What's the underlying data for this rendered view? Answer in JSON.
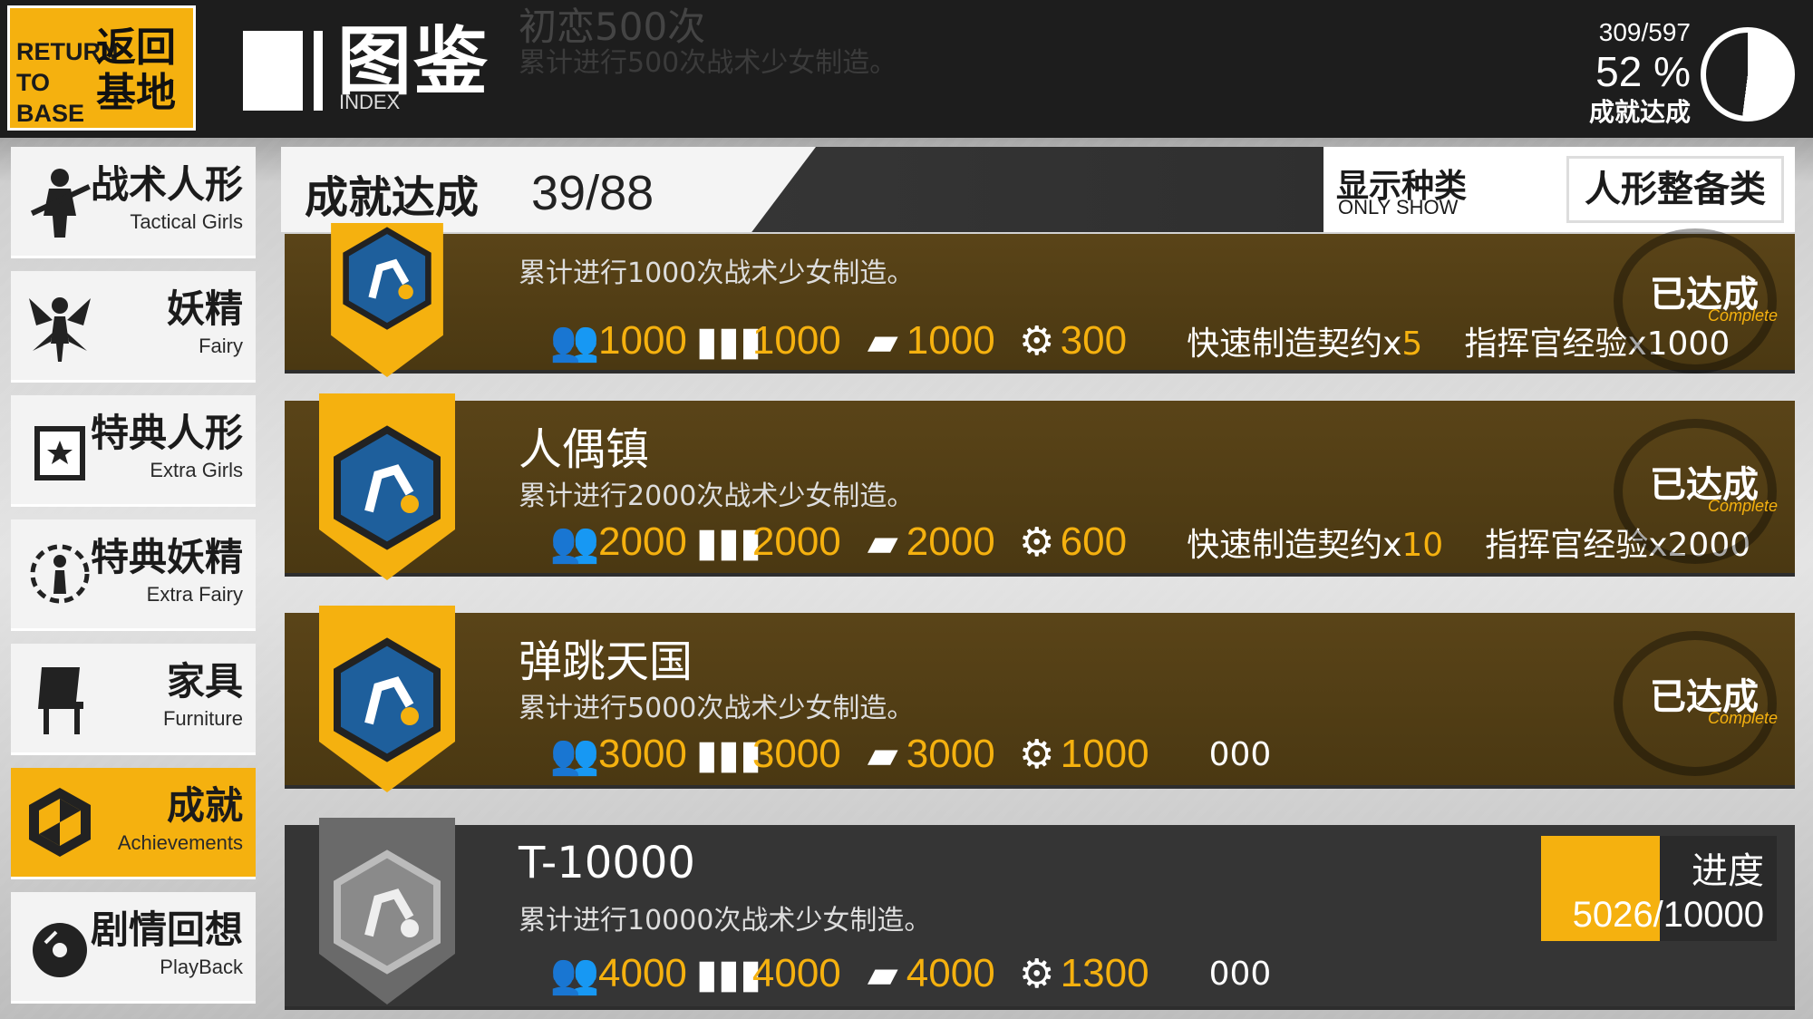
{
  "header": {
    "return_en": "RETURN TO BASE",
    "return_cn": "返回基地",
    "title_cn": "图鉴",
    "title_en": "INDEX",
    "ghost_title": "初恋500次",
    "ghost_desc": "累计进行500次战术少女制造。",
    "progress_count": "309/597",
    "progress_pct": "52 %",
    "progress_pct_value": 0.52,
    "progress_label": "成就达成"
  },
  "sidebar": {
    "items": [
      {
        "cn": "战术人形",
        "en": "Tactical Girls",
        "icon": "tactical-girl-icon"
      },
      {
        "cn": "妖精",
        "en": "Fairy",
        "icon": "fairy-icon"
      },
      {
        "cn": "特典人形",
        "en": "Extra Girls",
        "icon": "extra-girls-icon"
      },
      {
        "cn": "特典妖精",
        "en": "Extra Fairy",
        "icon": "extra-fairy-icon"
      },
      {
        "cn": "家具",
        "en": "Furniture",
        "icon": "chair-icon"
      },
      {
        "cn": "成就",
        "en": "Achievements",
        "icon": "achievement-hex-icon"
      },
      {
        "cn": "剧情回想",
        "en": "PlayBack",
        "icon": "disc-icon"
      }
    ],
    "active": "成就"
  },
  "filter": {
    "label": "成就达成",
    "value": "39/88",
    "show_label": "显示种类",
    "show_en": "ONLY SHOW",
    "selected": "人形整备类"
  },
  "cards": [
    {
      "title": "",
      "desc": "累计进行1000次战术少女制造。",
      "manpower": "1000",
      "ammo": "1000",
      "ration": "1000",
      "parts": "300",
      "extra1_text": "快速制造契约x",
      "extra1_num": "5",
      "extra2": "指挥官经验x1000",
      "status_cn": "已达成",
      "status_en": "Complete"
    },
    {
      "title": "人偶镇",
      "desc": "累计进行2000次战术少女制造。",
      "manpower": "2000",
      "ammo": "2000",
      "ration": "2000",
      "parts": "600",
      "extra1_text": "快速制造契约x",
      "extra1_num": "10",
      "extra2": "指挥官经验x2000",
      "status_cn": "已达成",
      "status_en": "Complete"
    },
    {
      "title": "弹跳天国",
      "desc": "累计进行5000次战术少女制造。",
      "manpower": "3000",
      "ammo": "3000",
      "ration": "3000",
      "parts": "1000",
      "extra_partial": "000",
      "status_cn": "已达成",
      "status_en": "Complete"
    },
    {
      "title": "T-10000",
      "desc": "累计进行10000次战术少女制造。",
      "manpower": "4000",
      "ammo": "4000",
      "ration": "4000",
      "parts": "1300",
      "extra_partial": "000",
      "progress_label": "进度",
      "progress_current": "5026",
      "progress_total": "/10000",
      "progress_fraction": 0.5026
    }
  ],
  "colors": {
    "accent": "#f5b10f",
    "card_complete": "#4a3812",
    "card_locked": "#353535"
  }
}
